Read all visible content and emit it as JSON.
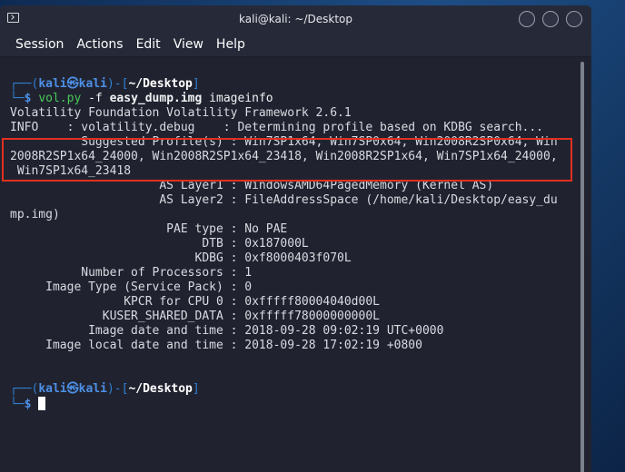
{
  "window": {
    "title": "kali@kali: ~/Desktop"
  },
  "menu": [
    "Session",
    "Actions",
    "Edit",
    "View",
    "Help"
  ],
  "prompt": {
    "bracket_open": "┌──(",
    "user": "kali",
    "at": "㉿",
    "host": "kali",
    "mid": ")-[",
    "path": "~/Desktop",
    "close": "]",
    "second_line": "└─",
    "dollar": "$"
  },
  "command": {
    "prog": "vol.py",
    "flag": "-f",
    "file": "easy_dump.img",
    "plugin": "imageinfo"
  },
  "output": [
    "Volatility Foundation Volatility Framework 2.6.1",
    "INFO    : volatility.debug    : Determining profile based on KDBG search...",
    "          Suggested Profile(s) : Win7SP1x64, Win7SP0x64, Win2008R2SP0x64, Win",
    "2008R2SP1x64_24000, Win2008R2SP1x64_23418, Win2008R2SP1x64, Win7SP1x64_24000,",
    " Win7SP1x64_23418",
    "                     AS Layer1 : WindowsAMD64PagedMemory (Kernel AS)",
    "                     AS Layer2 : FileAddressSpace (/home/kali/Desktop/easy_du",
    "mp.img)",
    "                      PAE type : No PAE",
    "                           DTB : 0x187000L",
    "                          KDBG : 0xf8000403f070L",
    "          Number of Processors : 1",
    "     Image Type (Service Pack) : 0",
    "                KPCR for CPU 0 : 0xfffff80004040d00L",
    "             KUSER_SHARED_DATA : 0xfffff78000000000L",
    "           Image date and time : 2018-09-28 09:02:19 UTC+0000",
    "     Image local date and time : 2018-09-28 17:02:19 +0800"
  ]
}
